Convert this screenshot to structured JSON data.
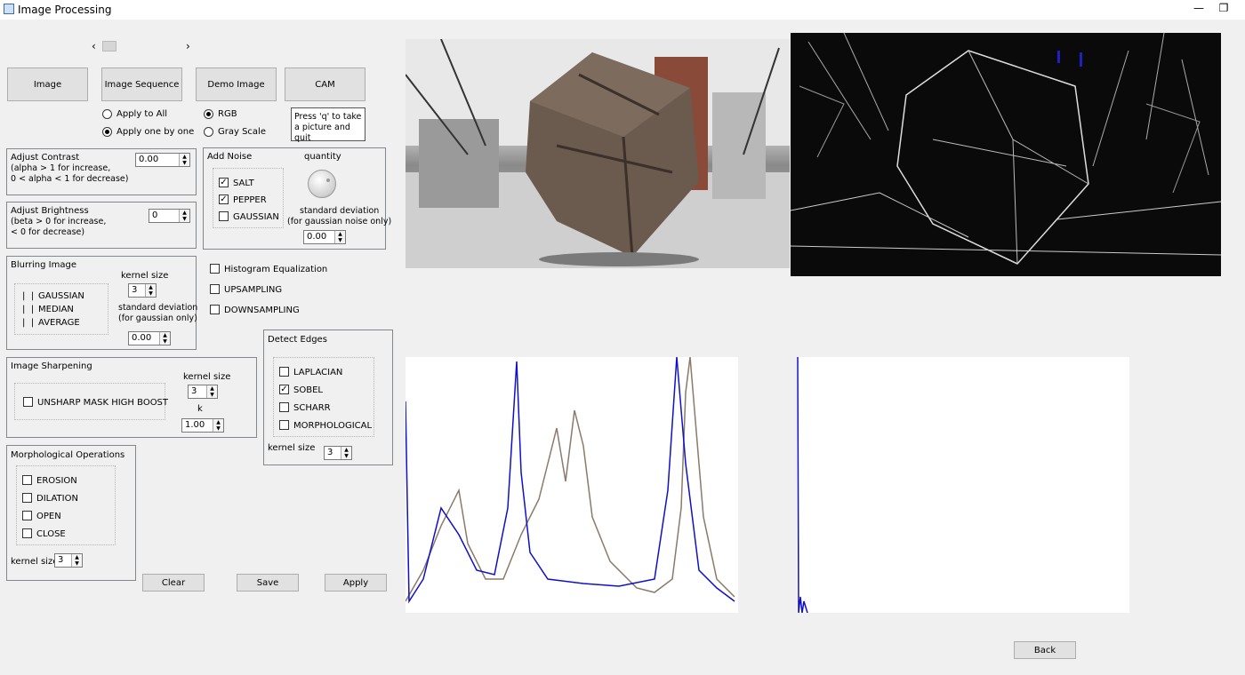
{
  "window": {
    "title": "Image Processing"
  },
  "scroll": {
    "left": "‹",
    "right": "›"
  },
  "sources": {
    "image": "Image",
    "sequence": "Image Sequence",
    "demo": "Demo Image",
    "cam": "CAM"
  },
  "apply_mode": {
    "all": "Apply to All",
    "one": "Apply one by one",
    "selected": "one"
  },
  "color_mode": {
    "rgb": "RGB",
    "gray": "Gray Scale",
    "selected": "rgb"
  },
  "cam_hint": {
    "line1": "Press 'q' to take",
    "line2": "a picture and quit"
  },
  "contrast": {
    "title": "Adjust Contrast",
    "hint1": "(alpha > 1 for increase,",
    "hint2": "0 < alpha < 1 for decrease)",
    "value": "0.00"
  },
  "brightness": {
    "title": "Adjust Brightness",
    "hint1": "(beta > 0 for increase,",
    "hint2": "< 0 for decrease)",
    "value": "0"
  },
  "noise": {
    "title": "Add Noise",
    "salt": "SALT",
    "pepper": "PEPPER",
    "gaussian": "GAUSSIAN",
    "quantity_label": "quantity",
    "std_label1": "standard deviation",
    "std_label2": "(for gaussian noise only)",
    "std_value": "0.00",
    "checked": {
      "salt": true,
      "pepper": true,
      "gaussian": false
    }
  },
  "blur": {
    "title": "Blurring Image",
    "gaussian": "GAUSSIAN",
    "median": "MEDIAN",
    "average": "AVERAGE",
    "kernel_label": "kernel size",
    "kernel_value": "3",
    "std_label1": "standard deviation",
    "std_label2": "(for gaussian only)",
    "std_value": "0.00"
  },
  "options": {
    "hist_eq": "Histogram Equalization",
    "upsampling": "UPSAMPLING",
    "downsampling": "DOWNSAMPLING"
  },
  "sharpen": {
    "title": "Image Sharpening",
    "unsharp": "UNSHARP MASK  HIGH BOOST",
    "kernel_label": "kernel size",
    "kernel_value": "3",
    "k_label": "k",
    "k_value": "1.00"
  },
  "edges": {
    "title": "Detect Edges",
    "laplacian": "LAPLACIAN",
    "sobel": "SOBEL",
    "scharr": "SCHARR",
    "morphological": "MORPHOLOGICAL",
    "kernel_label": "kernel size",
    "kernel_value": "3",
    "checked": {
      "laplacian": false,
      "sobel": true,
      "scharr": false,
      "morphological": false
    }
  },
  "morph": {
    "title": "Morphological Operations",
    "erosion": "EROSION",
    "dilation": "DILATION",
    "open": "OPEN",
    "close": "CLOSE",
    "kernel_label": "kernel size",
    "kernel_value": "3"
  },
  "actions": {
    "clear": "Clear",
    "save": "Save",
    "apply": "Apply",
    "back": "Back"
  },
  "colors": {
    "hist_blue": "#1010c8",
    "hist_gray": "#8a7a6a"
  }
}
